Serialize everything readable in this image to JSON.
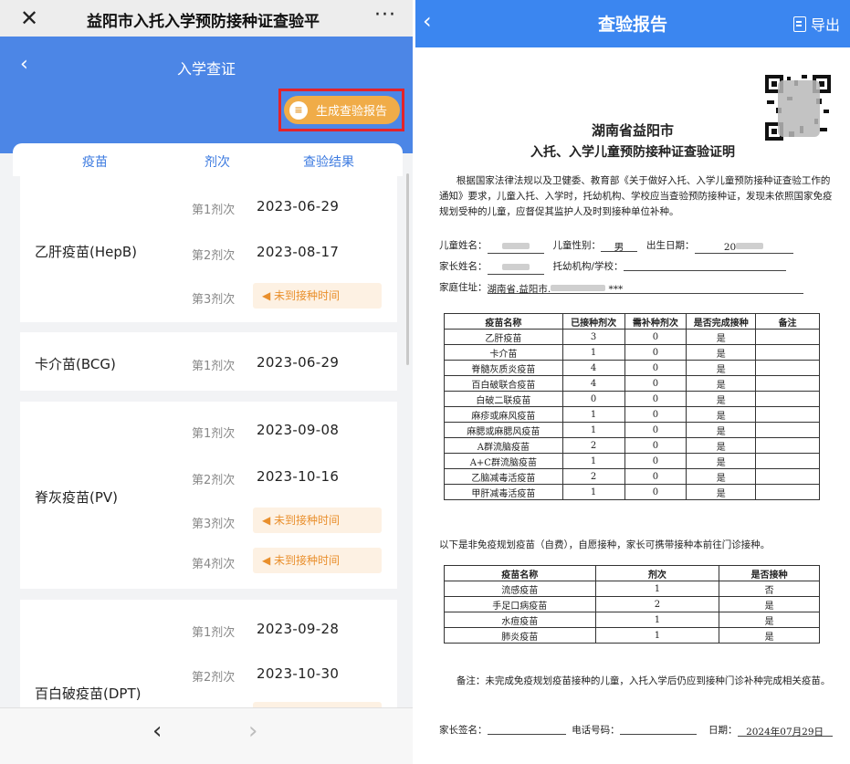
{
  "wechat_bar": {
    "close": "✕",
    "title": "益阳市入托入学预防接种证查验平",
    "more": "···"
  },
  "header": {
    "back": "‹",
    "title": "入学查证"
  },
  "generate_button": {
    "label": "生成查验报告",
    "icon": "document-icon"
  },
  "columns": {
    "vaccine": "疫苗",
    "dose": "剂次",
    "result": "查验结果"
  },
  "vaccines": [
    {
      "name": "乙肝疫苗(HepB)",
      "doses": [
        {
          "label": "第1剂次",
          "date": "2023-06-29"
        },
        {
          "label": "第2剂次",
          "date": "2023-08-17"
        },
        {
          "label": "第3剂次",
          "status": "◀ 未到接种时间"
        }
      ]
    },
    {
      "name": "卡介苗(BCG)",
      "doses": [
        {
          "label": "第1剂次",
          "date": "2023-06-29"
        }
      ]
    },
    {
      "name": "脊灰疫苗(PV)",
      "doses": [
        {
          "label": "第1剂次",
          "date": "2023-09-08"
        },
        {
          "label": "第2剂次",
          "date": "2023-10-16"
        },
        {
          "label": "第3剂次",
          "status": "◀ 未到接种时间"
        },
        {
          "label": "第4剂次",
          "status": "◀ 未到接种时间"
        }
      ]
    },
    {
      "name": "百白破疫苗(DPT)",
      "doses": [
        {
          "label": "第1剂次",
          "date": "2023-09-28"
        },
        {
          "label": "第2剂次",
          "date": "2023-10-30"
        }
      ]
    }
  ],
  "bottom_nav": {
    "back": "‹",
    "forward": "›"
  },
  "report_bar": {
    "back": "‹",
    "title": "查验报告",
    "export": "导出"
  },
  "report": {
    "title1": "湖南省益阳市",
    "title2": "入托、入学儿童预防接种证查验证明",
    "intro": "根据国家法律法规以及卫健委、教育部《关于做好入托、入学儿童预防接种证查验工作的通知》要求，儿童入托、入学时，托幼机构、学校应当查验预防接种证，发现未依照国家免疫规划受种的儿童，应督促其监护人及时到接种单位补种。",
    "child_name_label": "儿童姓名：",
    "child_sex_label": "儿童性别：",
    "child_sex": "男",
    "birth_label": "出生日期：",
    "birth_value": "20",
    "parent_name_label": "家长姓名：",
    "school_label": "托幼机构/学校：",
    "address_label": "家庭住址：",
    "address_value": "湖南省.益阳市.",
    "address_mask": "***",
    "table1_headers": [
      "疫苗名称",
      "已接种剂次",
      "需补种剂次",
      "是否完成接种",
      "备注"
    ],
    "table1_rows": [
      [
        "乙肝疫苗",
        "3",
        "0",
        "是",
        ""
      ],
      [
        "卡介苗",
        "1",
        "0",
        "是",
        ""
      ],
      [
        "脊髓灰质炎疫苗",
        "4",
        "0",
        "是",
        ""
      ],
      [
        "百白破联合疫苗",
        "4",
        "0",
        "是",
        ""
      ],
      [
        "白破二联疫苗",
        "0",
        "0",
        "是",
        ""
      ],
      [
        "麻疹或麻风疫苗",
        "1",
        "0",
        "是",
        ""
      ],
      [
        "麻腮或麻腮风疫苗",
        "1",
        "0",
        "是",
        ""
      ],
      [
        "A群流脑疫苗",
        "2",
        "0",
        "是",
        ""
      ],
      [
        "A+C群流脑疫苗",
        "1",
        "0",
        "是",
        ""
      ],
      [
        "乙脑减毒活疫苗",
        "2",
        "0",
        "是",
        ""
      ],
      [
        "甲肝减毒活疫苗",
        "1",
        "0",
        "是",
        ""
      ]
    ],
    "non_program_note": "以下是非免疫规划疫苗（自费），自愿接种，家长可携带接种本前往门诊接种。",
    "table2_headers": [
      "疫苗名称",
      "剂次",
      "是否接种"
    ],
    "table2_rows": [
      [
        "流感疫苗",
        "1",
        "否"
      ],
      [
        "手足口病疫苗",
        "2",
        "是"
      ],
      [
        "水痘疫苗",
        "1",
        "是"
      ],
      [
        "肺炎疫苗",
        "1",
        "是"
      ]
    ],
    "remark": "备注：未完成免疫规划疫苗接种的儿童，入托入学后仍应到接种门诊补种完成相关疫苗。",
    "parent_sign_label": "家长签名：",
    "phone_label": "电话号码：",
    "date_label": "日期：",
    "date_value": "2024年07月29日"
  }
}
